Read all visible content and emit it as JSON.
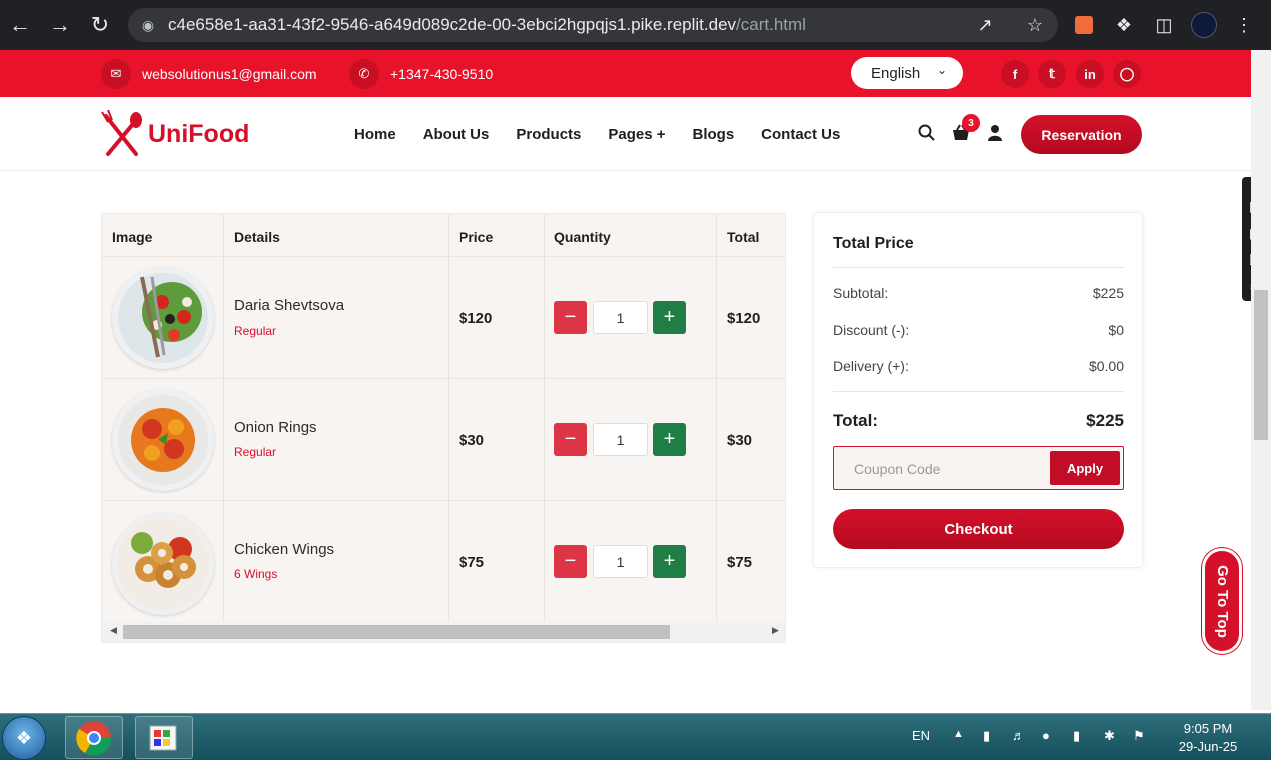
{
  "browser": {
    "url_host": "c4e658e1-aa31-43f2-9546-a649d089c2de-00-3ebci2hgpqjs1.pike.replit.dev",
    "url_path": "/cart.html"
  },
  "topbar": {
    "email": "websolutionus1@gmail.com",
    "phone": "+1347-430-9510",
    "language": "English",
    "social": [
      "f",
      "t",
      "in",
      "ig"
    ]
  },
  "header": {
    "logo": "UniFood",
    "menu": [
      "Home",
      "About Us",
      "Products",
      "Pages +",
      "Blogs",
      "Contact Us"
    ],
    "cart_count": "3",
    "reservation": "Reservation"
  },
  "cart": {
    "columns": [
      "Image",
      "Details",
      "Price",
      "Quantity",
      "Total"
    ],
    "rows": [
      {
        "name": "Daria Shevtsova",
        "variant": "Regular",
        "price": "$120",
        "qty": "1",
        "total": "$120"
      },
      {
        "name": "Onion Rings",
        "variant": "Regular",
        "price": "$30",
        "qty": "1",
        "total": "$30"
      },
      {
        "name": "Chicken Wings",
        "variant": "6 Wings",
        "price": "$75",
        "qty": "1",
        "total": "$75"
      }
    ]
  },
  "summary": {
    "title": "Total Price",
    "subtotal_label": "Subtotal:",
    "subtotal": "$225",
    "discount_label": "Discount (-):",
    "discount": "$0",
    "delivery_label": "Delivery (+):",
    "delivery": "$0.00",
    "total_label": "Total:",
    "total": "$225",
    "coupon_placeholder": "Coupon Code",
    "apply": "Apply",
    "checkout": "Checkout"
  },
  "go_to_top": "Go To Top",
  "taskbar": {
    "lang": "EN",
    "time": "9:05 PM",
    "date": "29-Jun-25"
  },
  "colors": {
    "brand_red": "#e8132a",
    "minus": "#dc3545",
    "plus": "#1e7e46"
  }
}
